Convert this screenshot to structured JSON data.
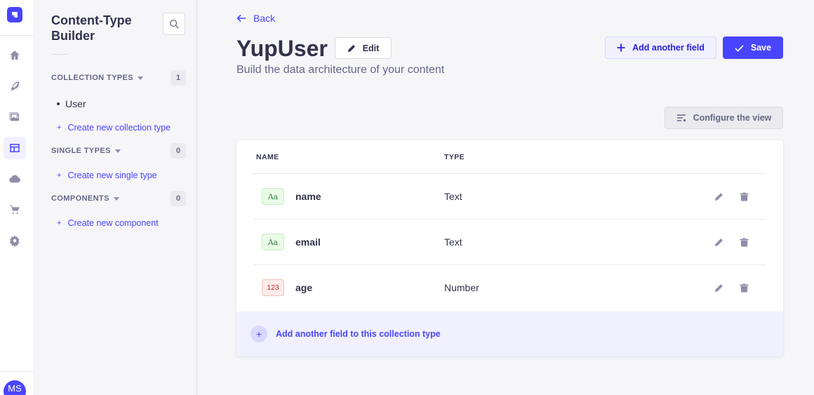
{
  "rail": {
    "avatar_initials": "MS",
    "icons": [
      "strapi-logo-icon",
      "home-icon",
      "content-manager-icon",
      "media-library-icon",
      "content-type-builder-icon",
      "cloud-icon",
      "marketplace-cart-icon",
      "settings-gear-icon"
    ]
  },
  "sidebar": {
    "title": "Content-Type Builder",
    "collection_types": {
      "label": "COLLECTION TYPES",
      "count": "1",
      "items": [
        {
          "label": "User"
        }
      ],
      "create_label": "Create new collection type"
    },
    "single_types": {
      "label": "SINGLE TYPES",
      "count": "0",
      "create_label": "Create new single type"
    },
    "components": {
      "label": "COMPONENTS",
      "count": "0",
      "create_label": "Create new component"
    }
  },
  "header": {
    "back_label": "Back",
    "title": "YupUser",
    "edit_label": "Edit",
    "subtitle": "Build the data architecture of your content",
    "add_field_label": "Add another field",
    "save_label": "Save",
    "configure_label": "Configure the view"
  },
  "table": {
    "columns": {
      "name": "NAME",
      "type": "TYPE"
    },
    "rows": [
      {
        "icon_text": "Aa",
        "name": "name",
        "type": "Text"
      },
      {
        "icon_text": "Aa",
        "name": "email",
        "type": "Text"
      },
      {
        "icon_text": "123",
        "name": "age",
        "type": "Number"
      }
    ],
    "add_field_label": "Add another field to this collection type"
  },
  "colors": {
    "primary": "#4945ff",
    "primary_light": "#f0f0ff",
    "text_badge_bg": "#eafbe7",
    "number_badge_bg": "#fcecea"
  }
}
